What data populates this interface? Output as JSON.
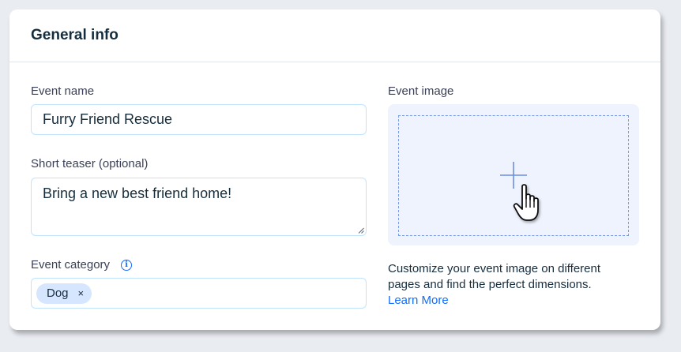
{
  "card": {
    "title": "General info"
  },
  "event_name": {
    "label": "Event name",
    "value": "Furry Friend Rescue"
  },
  "short_teaser": {
    "label": "Short teaser (optional)",
    "value": "Bring a new best friend home!"
  },
  "event_category": {
    "label": "Event category",
    "info_icon": "info-icon",
    "tags": [
      {
        "label": "Dog",
        "remove_symbol": "×"
      }
    ]
  },
  "event_image": {
    "label": "Event image",
    "add_icon": "plus-icon",
    "cursor_icon": "hand-pointer-icon",
    "helper_text_line1": "Customize your event image on different",
    "helper_text_line2": "pages and find the perfect dimensions.",
    "learn_more": "Learn More"
  },
  "colors": {
    "accent": "#116dff",
    "text": "#162d3d",
    "input_border": "#c1e4fe",
    "image_bg": "#eef3fd",
    "tag_bg": "#d6e6fe"
  }
}
